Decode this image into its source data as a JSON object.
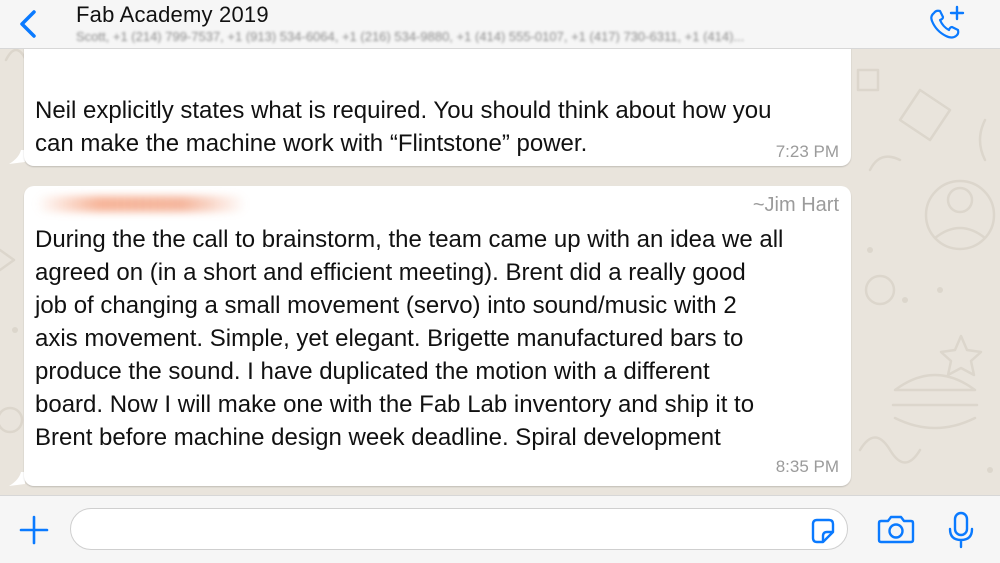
{
  "header": {
    "title": "Fab Academy 2019",
    "participants": "Scott, +1 (214) 799-7537, +1 (913) 534-6064, +1 (216) 534-9880, +1 (414) 555-0107, +1 (417) 730-6311, +1 (414)..."
  },
  "messages": [
    {
      "lines": [
        "Neil explicitly states what is required.  You should think about how you",
        "can make the machine work with “Flintstone” power."
      ],
      "time": "7:23 PM"
    },
    {
      "sender": "~Jim Hart",
      "lines": [
        "During the the call to brainstorm, the team came up with an idea we all",
        "agreed on (in a short and efficient meeting). Brent did a really good",
        "job of changing a small movement (servo) into sound/music with 2",
        "axis movement. Simple, yet elegant. Brigette manufactured bars to",
        "produce the sound. I have duplicated the motion with a different",
        "board. Now I will make one with the Fab Lab inventory and ship it to",
        "Brent before machine design week deadline. Spiral development"
      ],
      "time": "8:35 PM"
    }
  ],
  "composer": {
    "value": ""
  },
  "icons": {
    "back": "chevron-left-icon",
    "call": "add-call-icon",
    "attach": "plus-icon",
    "sticker": "sticker-icon",
    "camera": "camera-icon",
    "mic": "microphone-icon"
  },
  "colors": {
    "accent": "#0a7aff",
    "bubble": "#ffffff",
    "wallpaper": "#e9e4dc"
  }
}
